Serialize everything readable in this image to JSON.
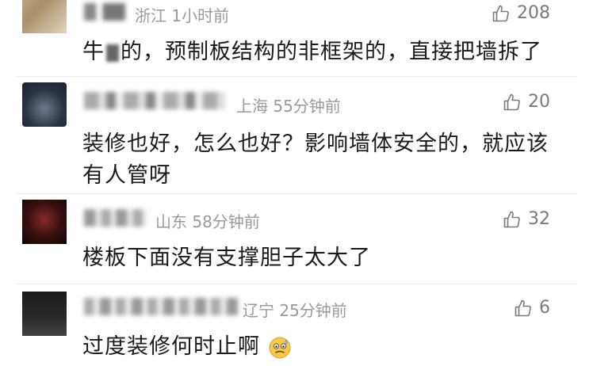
{
  "comments": [
    {
      "location": "浙江",
      "time": "1小时前",
      "likes": "208",
      "text_before": "牛",
      "text_after": "的，预制板结构的非框架的，直接把墙拆了"
    },
    {
      "location": "上海",
      "time": "55分钟前",
      "likes": "20",
      "line1": "装修也好，怎么也好？影响墙体安全的，就应该",
      "line2": "有人管呀"
    },
    {
      "location": "山东",
      "time": "58分钟前",
      "likes": "32",
      "text": "楼板下面没有支撑胆子太大了"
    },
    {
      "location": "辽宁",
      "time": "25分钟前",
      "likes": "6",
      "text": "过度装修何时止啊"
    }
  ],
  "icons": {
    "like": "thumbs-up-outline-icon",
    "emoji": "cold-sweat-face-emoji"
  },
  "colors": {
    "meta": "#9a9a9a",
    "text": "#1a1a1a",
    "likes": "#7a7a7a"
  }
}
